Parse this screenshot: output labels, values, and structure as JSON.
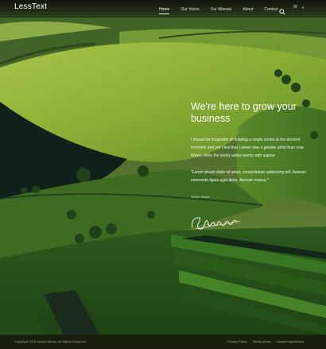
{
  "brand": {
    "logo": "LessText"
  },
  "nav": {
    "items": [
      {
        "label": "Home",
        "active": true
      },
      {
        "label": "Our Vision",
        "active": false
      },
      {
        "label": "Our Mission",
        "active": false
      },
      {
        "label": "About",
        "active": false
      },
      {
        "label": "Contact",
        "active": false
      }
    ],
    "search_icon": "search-icon",
    "language": "IR"
  },
  "hero": {
    "headline": "We're here to grow your business",
    "paragraph": "I should be incapable of drawing a single stroke at the present moment; and yet I feel that I never was a greater artist than now. When, while the lovely valley teems with vapour",
    "quote": "\"Lorem ipsum dolor sit amet, consectetuer adipiscing elit. Aenean commodo ligula eget dolor. Aenean massa.\"",
    "author": "Simon Ricker"
  },
  "footer": {
    "copyright": "Copyright 2018 Seoleb Media. All Rights Reserved.",
    "links": [
      "Privacy Policy",
      "Terms of use",
      "License Agreement"
    ]
  },
  "colors": {
    "accent": "#ffffff",
    "header_bg": "#0b0f0c",
    "field_dark": "#0d1a10",
    "field_light": "#9bbf3d"
  }
}
